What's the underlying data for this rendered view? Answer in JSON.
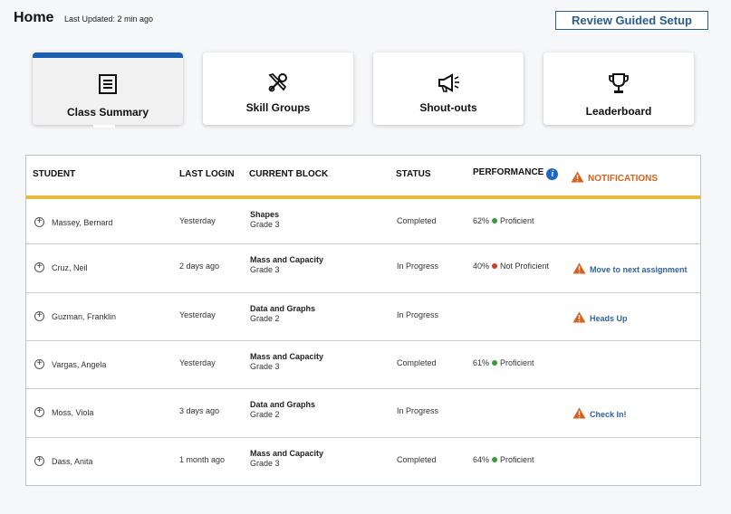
{
  "header": {
    "title": "Home",
    "last_updated": "Last Updated: 2 min ago",
    "guided_setup_label": "Review Guided Setup"
  },
  "tabs": [
    {
      "label": "Class Summary",
      "icon": "list-icon",
      "active": true
    },
    {
      "label": "Skill Groups",
      "icon": "tools-icon",
      "active": false
    },
    {
      "label": "Shout-outs",
      "icon": "megaphone-icon",
      "active": false
    },
    {
      "label": "Leaderboard",
      "icon": "trophy-icon",
      "active": false
    }
  ],
  "table": {
    "columns": {
      "student": "STUDENT",
      "last_login": "LAST LOGIN",
      "current_block": "CURRENT BLOCK",
      "status": "STATUS",
      "performance": "PERFORMANCE",
      "notifications": "NOTIFICATIONS"
    },
    "rows": [
      {
        "student": "Massey, Bernard",
        "last_login": "Yesterday",
        "block": "Shapes",
        "grade": "Grade 3",
        "status": "Completed",
        "score": "62%",
        "level": "Proficient",
        "level_color": "#3a9a3a",
        "notification": ""
      },
      {
        "student": "Cruz, Neil",
        "last_login": "2 days ago",
        "block": "Mass and Capacity",
        "grade": "Grade 3",
        "status": "In Progress",
        "score": "40%",
        "level": "Not Proficient",
        "level_color": "#d23a2e",
        "notification": "Move to next assignment"
      },
      {
        "student": "Guzman, Franklin",
        "last_login": "Yesterday",
        "block": "Data and Graphs",
        "grade": "Grade 2",
        "status": "In Progress",
        "score": "",
        "level": "",
        "level_color": "",
        "notification": "Heads Up"
      },
      {
        "student": "Vargas, Angela",
        "last_login": "Yesterday",
        "block": "Mass and Capacity",
        "grade": "Grade 3",
        "status": "Completed",
        "score": "61%",
        "level": "Proficient",
        "level_color": "#3a9a3a",
        "notification": ""
      },
      {
        "student": "Moss, Viola",
        "last_login": "3 days ago",
        "block": "Data and Graphs",
        "grade": "Grade 2",
        "status": "In Progress",
        "score": "",
        "level": "",
        "level_color": "",
        "notification": "Check In!"
      },
      {
        "student": "Dass, Anita",
        "last_login": "1 month ago",
        "block": "Mass and Capacity",
        "grade": "Grade 3",
        "status": "Completed",
        "score": "64%",
        "level": "Proficient",
        "level_color": "#3a9a3a",
        "notification": ""
      }
    ]
  },
  "colors": {
    "accent": "#1c5fb0",
    "header_underline": "#e6b936",
    "warning": "#d4621c",
    "link": "#3163a8"
  }
}
